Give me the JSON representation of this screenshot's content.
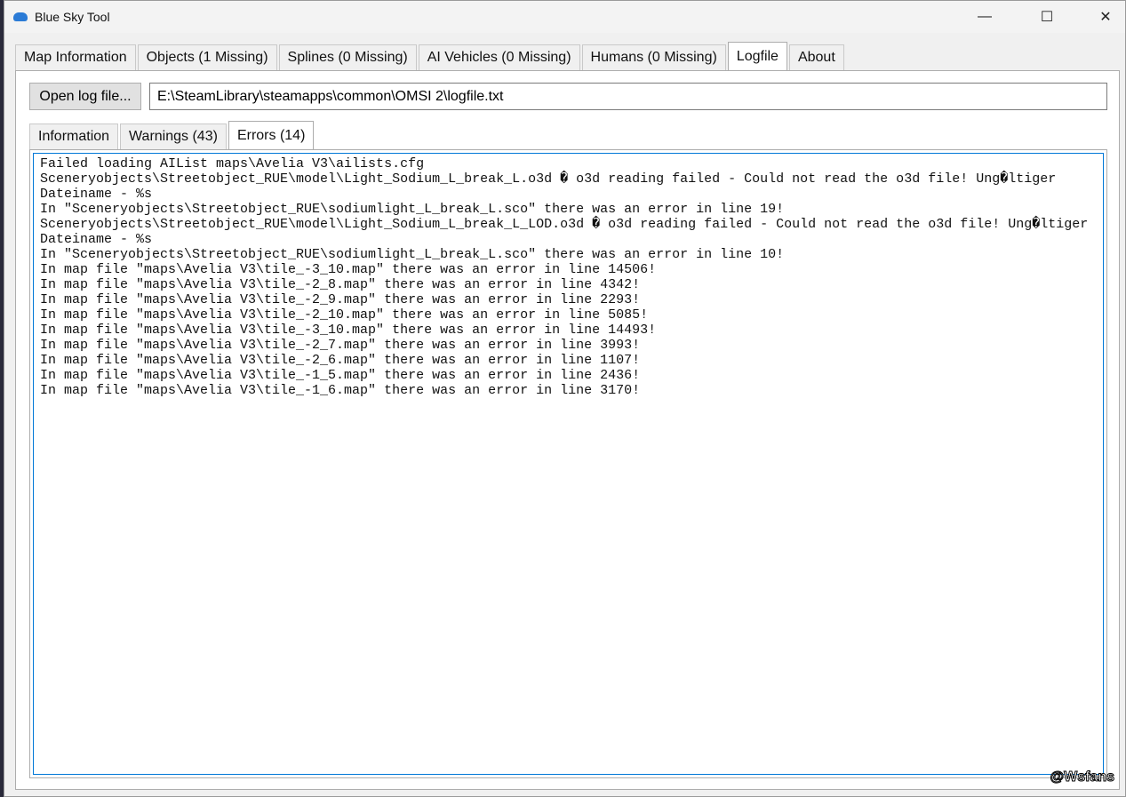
{
  "window": {
    "title": "Blue Sky Tool",
    "minimize": "—",
    "maximize": "☐",
    "close": "✕"
  },
  "main_tabs": [
    "Map Information",
    "Objects (1 Missing)",
    "Splines (0 Missing)",
    "AI Vehicles (0 Missing)",
    "Humans (0 Missing)",
    "Logfile",
    "About"
  ],
  "open_button": "Open log file...",
  "path": "E:\\SteamLibrary\\steamapps\\common\\OMSI 2\\logfile.txt",
  "sub_tabs": [
    "Information",
    "Warnings (43)",
    "Errors (14)"
  ],
  "log_lines": [
    "Failed loading AIList maps\\Avelia V3\\ailists.cfg",
    "Sceneryobjects\\Streetobject_RUE\\model\\Light_Sodium_L_break_L.o3d � o3d reading failed - Could not read the o3d file! Ung�ltiger",
    "Dateiname - %s",
    "In \"Sceneryobjects\\Streetobject_RUE\\sodiumlight_L_break_L.sco\" there was an error in line 19!",
    "Sceneryobjects\\Streetobject_RUE\\model\\Light_Sodium_L_break_L_LOD.o3d � o3d reading failed - Could not read the o3d file! Ung�ltiger",
    "Dateiname - %s",
    "In \"Sceneryobjects\\Streetobject_RUE\\sodiumlight_L_break_L.sco\" there was an error in line 10!",
    "In map file \"maps\\Avelia V3\\tile_-3_10.map\" there was an error in line 14506!",
    "In map file \"maps\\Avelia V3\\tile_-2_8.map\" there was an error in line 4342!",
    "In map file \"maps\\Avelia V3\\tile_-2_9.map\" there was an error in line 2293!",
    "In map file \"maps\\Avelia V3\\tile_-2_10.map\" there was an error in line 5085!",
    "In map file \"maps\\Avelia V3\\tile_-3_10.map\" there was an error in line 14493!",
    "In map file \"maps\\Avelia V3\\tile_-2_7.map\" there was an error in line 3993!",
    "In map file \"maps\\Avelia V3\\tile_-2_6.map\" there was an error in line 1107!",
    "In map file \"maps\\Avelia V3\\tile_-1_5.map\" there was an error in line 2436!",
    "In map file \"maps\\Avelia V3\\tile_-1_6.map\" there was an error in line 3170!"
  ],
  "watermark": "@Wsfans"
}
